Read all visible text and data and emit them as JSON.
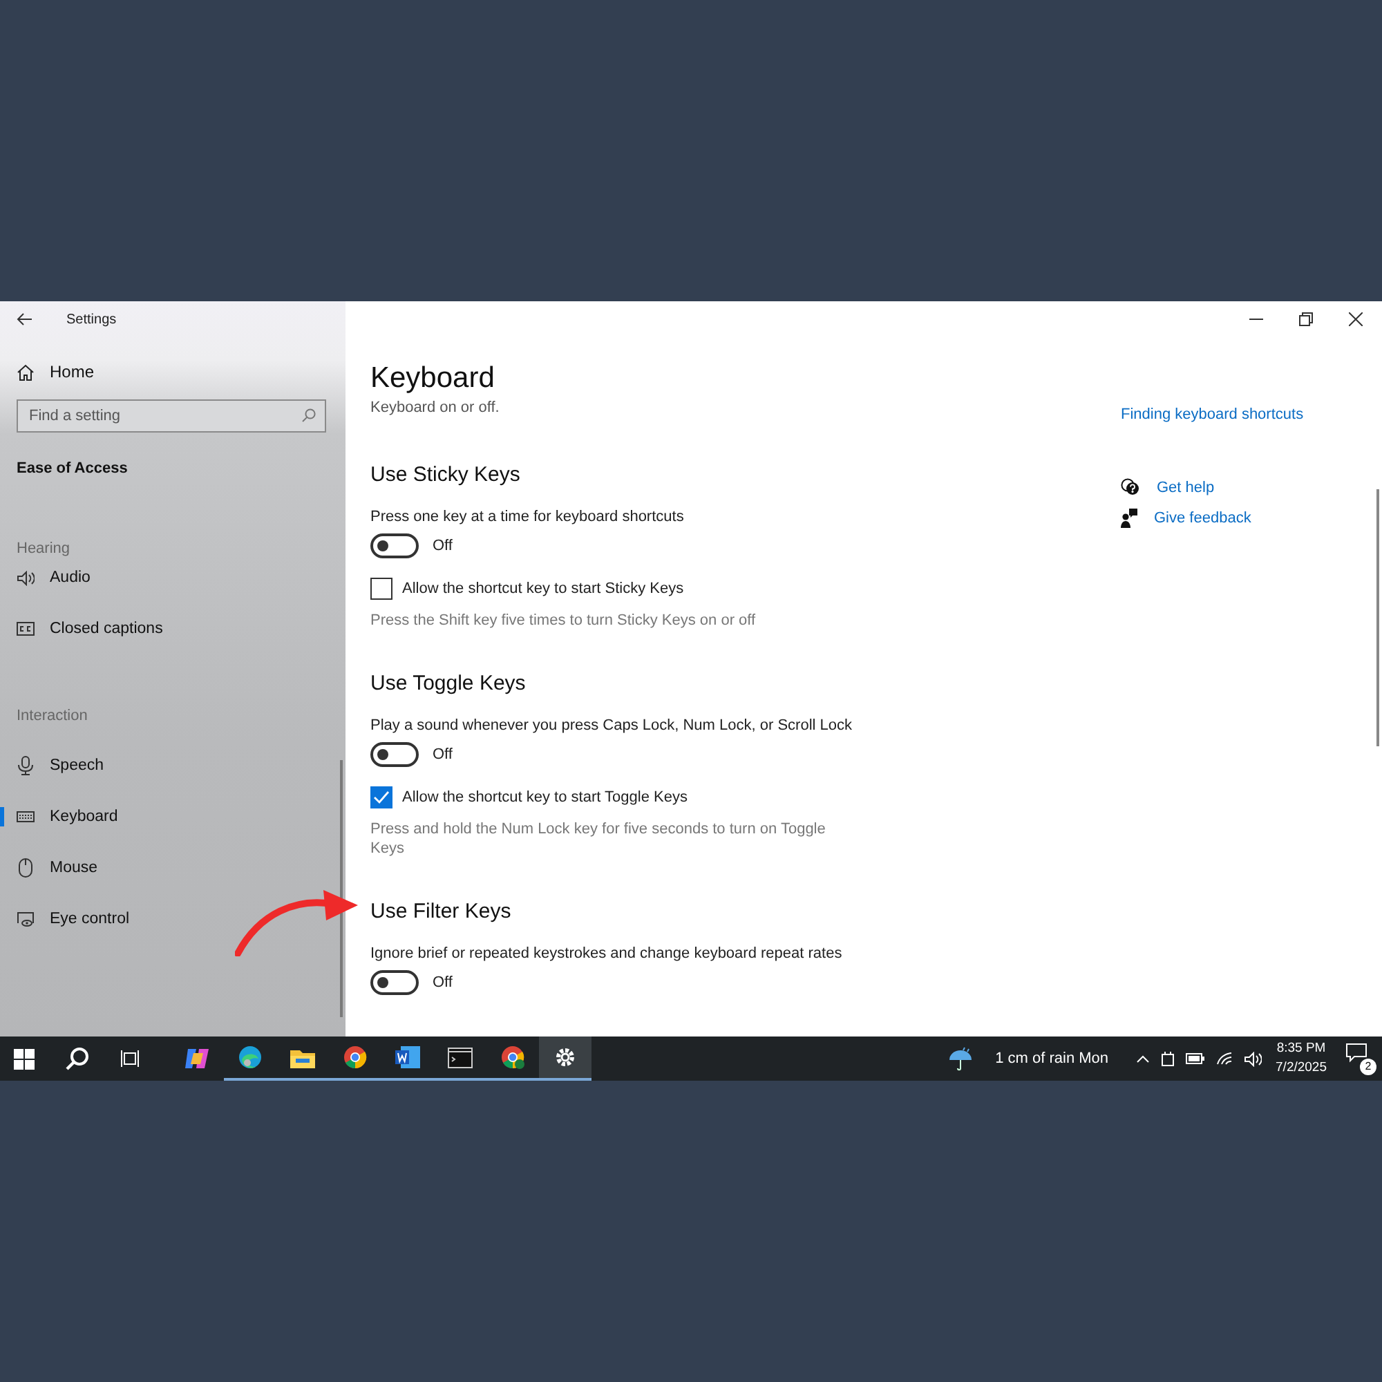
{
  "window": {
    "title": "Settings"
  },
  "sidebar": {
    "home": "Home",
    "search": {
      "placeholder": "Find a setting"
    },
    "category": "Ease of Access",
    "groups": [
      {
        "heading": "Hearing",
        "items": [
          {
            "label": "Audio",
            "kind": "audio",
            "selected": false
          },
          {
            "label": "Closed captions",
            "kind": "captions",
            "selected": false
          }
        ]
      },
      {
        "heading": "Interaction",
        "items": [
          {
            "label": "Speech",
            "kind": "speech",
            "selected": false
          },
          {
            "label": "Keyboard",
            "kind": "keyboard",
            "selected": true
          },
          {
            "label": "Mouse",
            "kind": "mouse",
            "selected": false
          },
          {
            "label": "Eye control",
            "kind": "eye",
            "selected": false
          }
        ]
      }
    ]
  },
  "main": {
    "title": "Keyboard",
    "intro": "Keyboard on or off.",
    "sections": [
      {
        "heading": "Use Sticky Keys",
        "description": "Press one key at a time for keyboard shortcuts",
        "toggle": {
          "on": false,
          "label": "Off"
        },
        "checkbox": {
          "checked": false,
          "label": "Allow the shortcut key to start Sticky Keys"
        },
        "note": "Press the Shift key five times to turn Sticky Keys on or off"
      },
      {
        "heading": "Use Toggle Keys",
        "description": "Play a sound whenever you press Caps Lock, Num Lock, or Scroll Lock",
        "toggle": {
          "on": false,
          "label": "Off"
        },
        "checkbox": {
          "checked": true,
          "label": "Allow the shortcut key to start Toggle Keys"
        },
        "note": "Press and hold the Num Lock key for five seconds to turn on Toggle Keys"
      },
      {
        "heading": "Use Filter Keys",
        "description": "Ignore brief or repeated keystrokes and change keyboard repeat rates",
        "toggle": {
          "on": false,
          "label": "Off"
        }
      }
    ]
  },
  "related": {
    "link": "Finding keyboard shortcuts",
    "help": [
      {
        "kind": "help",
        "label": "Get help"
      },
      {
        "kind": "feedback",
        "label": "Give feedback"
      }
    ]
  },
  "taskbar": {
    "apps": [
      {
        "kind": "copilot",
        "running": false,
        "selected": false
      },
      {
        "kind": "edge",
        "running": true,
        "selected": false
      },
      {
        "kind": "explorer",
        "running": true,
        "selected": false
      },
      {
        "kind": "chrome",
        "running": true,
        "selected": false
      },
      {
        "kind": "word",
        "running": true,
        "selected": false
      },
      {
        "kind": "terminal",
        "running": true,
        "selected": false
      },
      {
        "kind": "chrome-s",
        "running": true,
        "selected": false
      },
      {
        "kind": "settings",
        "running": true,
        "selected": true
      }
    ],
    "weather": "1 cm of rain Mon",
    "time": "8:35 PM",
    "date": "7/2/2025",
    "notifications": "2"
  }
}
